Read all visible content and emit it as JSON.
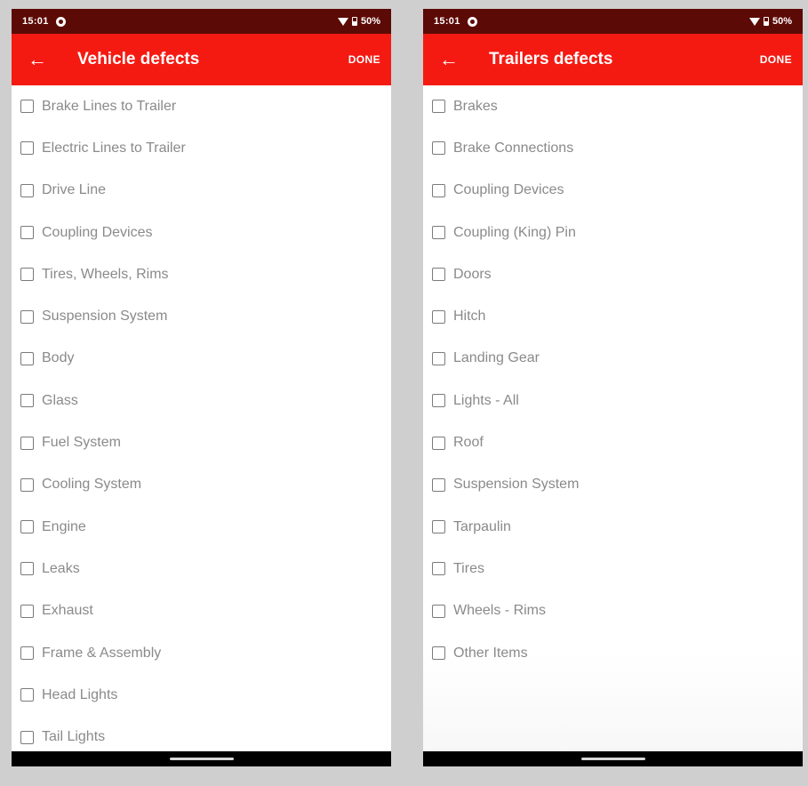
{
  "theme": {
    "status_bar_color": "#5c0a05",
    "app_bar_color": "#f41a12",
    "background": "#cfcfcf"
  },
  "left_screen": {
    "status": {
      "time": "15:01",
      "battery": "50%"
    },
    "app_bar": {
      "back_icon": "arrow-left-icon",
      "title": "Vehicle defects",
      "action": "DONE"
    },
    "items": [
      {
        "label": "Brake Lines to Trailer",
        "checked": false
      },
      {
        "label": "Electric Lines to Trailer",
        "checked": false
      },
      {
        "label": "Drive Line",
        "checked": false
      },
      {
        "label": "Coupling Devices",
        "checked": false
      },
      {
        "label": "Tires, Wheels, Rims",
        "checked": false
      },
      {
        "label": "Suspension System",
        "checked": false
      },
      {
        "label": "Body",
        "checked": false
      },
      {
        "label": "Glass",
        "checked": false
      },
      {
        "label": "Fuel System",
        "checked": false
      },
      {
        "label": "Cooling System",
        "checked": false
      },
      {
        "label": "Engine",
        "checked": false
      },
      {
        "label": "Leaks",
        "checked": false
      },
      {
        "label": "Exhaust",
        "checked": false
      },
      {
        "label": "Frame & Assembly",
        "checked": false
      },
      {
        "label": "Head Lights",
        "checked": false
      },
      {
        "label": "Tail Lights",
        "checked": false
      }
    ]
  },
  "right_screen": {
    "status": {
      "time": "15:01",
      "battery": "50%"
    },
    "app_bar": {
      "back_icon": "arrow-left-icon",
      "title": "Trailers defects",
      "action": "DONE"
    },
    "items": [
      {
        "label": "Brakes",
        "checked": false
      },
      {
        "label": "Brake Connections",
        "checked": false
      },
      {
        "label": "Coupling Devices",
        "checked": false
      },
      {
        "label": "Coupling (King) Pin",
        "checked": false
      },
      {
        "label": "Doors",
        "checked": false
      },
      {
        "label": "Hitch",
        "checked": false
      },
      {
        "label": "Landing Gear",
        "checked": false
      },
      {
        "label": "Lights - All",
        "checked": false
      },
      {
        "label": "Roof",
        "checked": false
      },
      {
        "label": "Suspension System",
        "checked": false
      },
      {
        "label": "Tarpaulin",
        "checked": false
      },
      {
        "label": "Tires",
        "checked": false
      },
      {
        "label": "Wheels - Rims",
        "checked": false
      },
      {
        "label": "Other Items",
        "checked": false
      }
    ]
  }
}
